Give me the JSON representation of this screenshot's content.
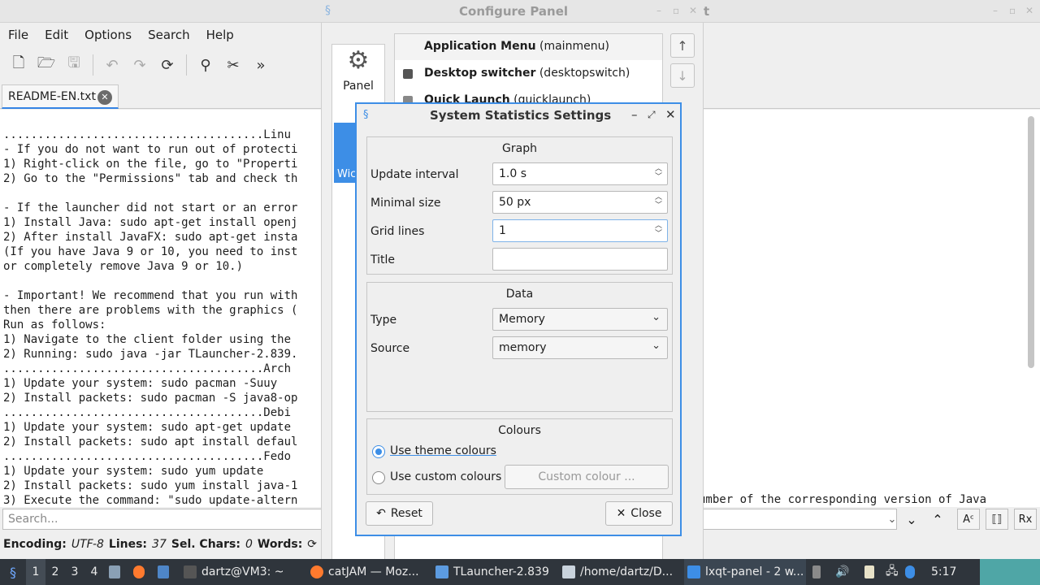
{
  "editor": {
    "window_title": "Configure Panel",
    "window_title_suffix": "t",
    "menu": [
      "File",
      "Edit",
      "Options",
      "Search",
      "Help"
    ],
    "tab_label": "README-EN.txt",
    "text_lines": [
      "......................................Linu",
      "- If you do not want to run out of protecti",
      "1) Right-click on the file, go to \"Properti",
      "2) Go to the \"Permissions\" tab and check th",
      "",
      "- If the launcher did not start or an error",
      "1) Install Java: sudo apt-get install openj",
      "2) After install JavaFX: sudo apt-get insta",
      "(If you have Java 9 or 10, you need to inst",
      "or completely remove Java 9 or 10.)",
      "",
      "- Important! We recommend that you run with",
      "then there are problems with the graphics (",
      "Run as follows:",
      "1) Navigate to the client folder using the ",
      "2) Running: sudo java -jar TLauncher-2.839.",
      "......................................Arch",
      "1) Update your system: sudo pacman -Suuy",
      "2) Install packets: sudo pacman -S java8-op",
      "......................................Debi",
      "1) Update your system: sudo apt-get update",
      "2) Install packets: sudo apt install defaul",
      "......................................Fedo",
      "1) Update your system: sudo yum update",
      "2) Install packets: sudo yum install java-1",
      "3) Execute the command: \"sudo update-altern"
    ],
    "text_right_fragment": "umber of the corresponding version of Java",
    "search_placeholder": "Search...",
    "status": {
      "encoding_label": "Encoding:",
      "encoding_value": "UTF-8",
      "lines_label": "Lines:",
      "lines_value": "37",
      "sel_label": "Sel. Chars:",
      "sel_value": "0",
      "words_label": "Words:"
    }
  },
  "configure_panel": {
    "sidebar_panel_label": "Panel",
    "sidebar_widgets_label": "Wic",
    "rows": [
      {
        "name": "Application Menu",
        "id": "(mainmenu)"
      },
      {
        "name": "Desktop switcher",
        "id": "(desktopswitch)"
      },
      {
        "name": "Quick Launch",
        "id": "(quicklaunch)"
      }
    ]
  },
  "dialog": {
    "title": "System Statistics Settings",
    "graph": {
      "heading": "Graph",
      "update_interval_label": "Update interval",
      "update_interval_value": "1.0 s",
      "minimal_size_label": "Minimal size",
      "minimal_size_value": "50 px",
      "grid_lines_label": "Grid lines",
      "grid_lines_value": "1",
      "title_label": "Title",
      "title_value": ""
    },
    "data": {
      "heading": "Data",
      "type_label": "Type",
      "type_value": "Memory",
      "source_label": "Source",
      "source_value": "memory"
    },
    "colours": {
      "heading": "Colours",
      "theme_label": "Use theme colours",
      "custom_label": "Use custom colours",
      "custom_button": "Custom colour ...",
      "selected": "theme"
    },
    "reset_label": "Reset",
    "close_label": "Close"
  },
  "taskbar": {
    "desktops": [
      "1",
      "2",
      "3",
      "4"
    ],
    "tasks": [
      {
        "label": "dartz@VM3: ~"
      },
      {
        "label": "catJAM — Moz..."
      },
      {
        "label": "TLauncher-2.839"
      },
      {
        "label": "/home/dartz/D..."
      },
      {
        "label": "lxqt-panel - 2 w..."
      }
    ],
    "clock": "5:17"
  },
  "colors": {
    "accent": "#3d8ee6",
    "taskbar_bg": "#2f353c"
  }
}
